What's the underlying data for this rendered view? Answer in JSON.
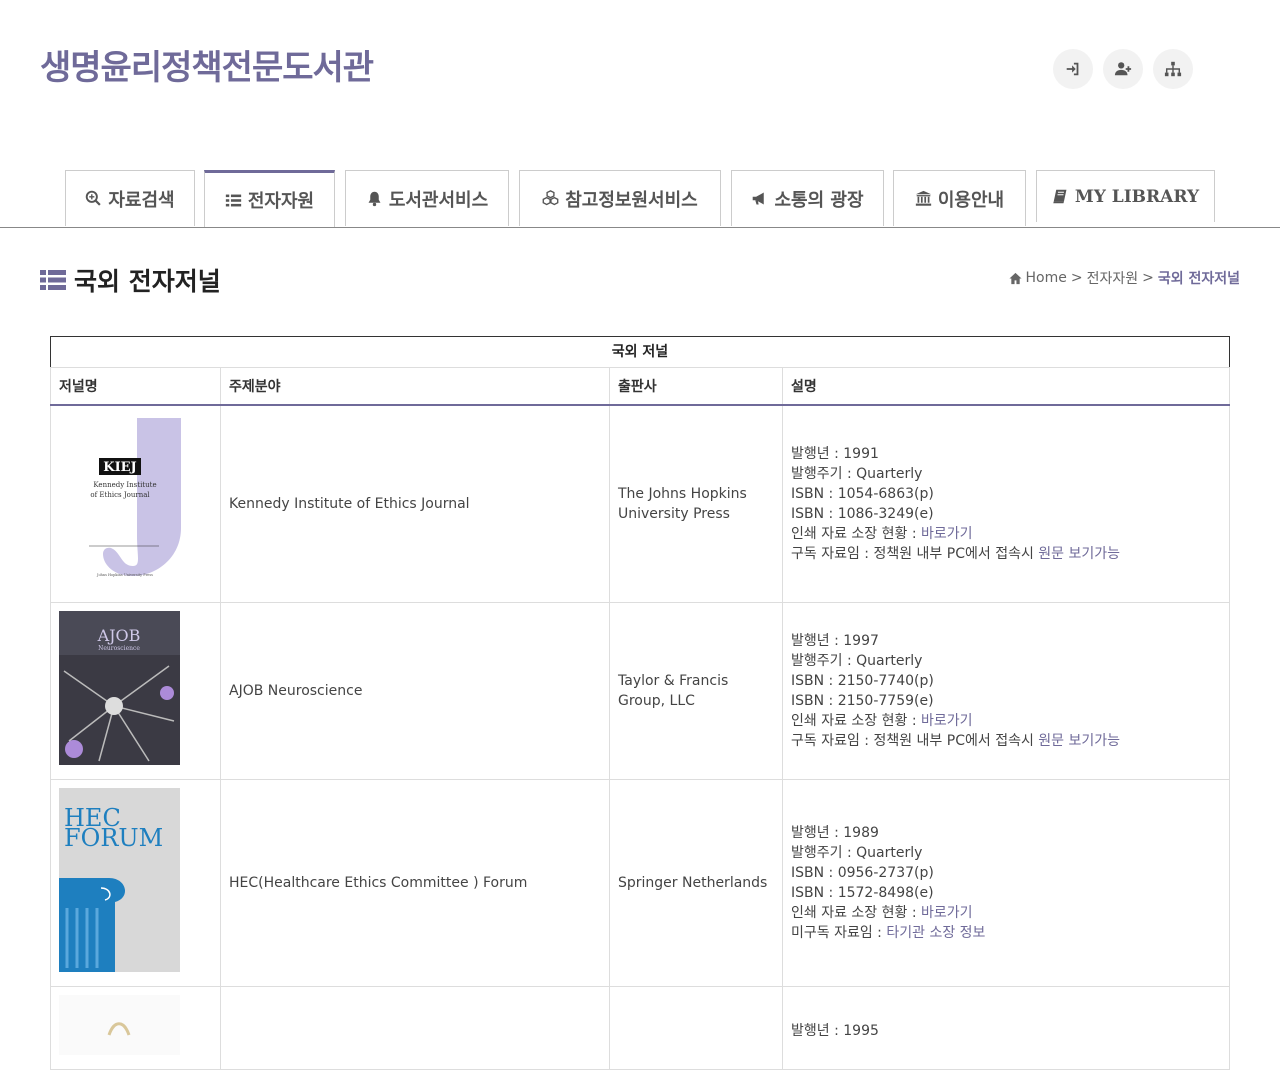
{
  "site": {
    "title": "생명윤리정책전문도서관"
  },
  "header_icons": [
    "login-icon",
    "user-plus-icon",
    "sitemap-icon"
  ],
  "nav": {
    "tabs": [
      "자료검색",
      "전자자원",
      "도서관서비스",
      "참고정보원서비스",
      "소통의 광장",
      "이용안내",
      "MY LIBRARY"
    ]
  },
  "page": {
    "title": "국외 전자저널",
    "breadcrumb": {
      "home": "Home",
      "sep": ">",
      "parent": "전자자원",
      "current": "국외 전자저널"
    }
  },
  "table": {
    "caption": "국외 저널",
    "headers": [
      "저널명",
      "주제분야",
      "출판사",
      "설명"
    ],
    "rows": [
      {
        "cover": {
          "title": "KIEJ",
          "subtitle1": "Kennedy Institute",
          "subtitle2": "of Ethics Journal",
          "footer": "Johns Hopkins University Press"
        },
        "subject": "Kennedy Institute of Ethics Journal",
        "publisher": "The Johns Hopkins University Press",
        "year": "발행년 : 1991",
        "cycle": "발행주기 : Quarterly",
        "isbn_p": "ISBN : 1054-6863(p)",
        "isbn_e": "ISBN : 1086-3249(e)",
        "print_label": "인쇄 자료 소장 현황 : ",
        "print_link": "바로가기",
        "sub_label": "구독 자료임 : 정책원 내부 PC에서 접속시 ",
        "sub_link": "원문 보기가능"
      },
      {
        "cover": {
          "title": "AJOB",
          "subtitle1": "Neuroscience"
        },
        "subject": "AJOB Neuroscience",
        "publisher": "Taylor & Francis Group, LLC",
        "year": "발행년 : 1997",
        "cycle": "발행주기 : Quarterly",
        "isbn_p": "ISBN : 2150-7740(p)",
        "isbn_e": "ISBN : 2150-7759(e)",
        "print_label": "인쇄 자료 소장 현황 : ",
        "print_link": "바로가기",
        "sub_label": "구독 자료임 : 정책원 내부 PC에서 접속시 ",
        "sub_link": "원문 보기가능"
      },
      {
        "cover": {
          "title1": "HEC",
          "title2": "FORUM"
        },
        "subject": "HEC(Healthcare Ethics Committee ) Forum",
        "publisher": "Springer Netherlands",
        "year": "발행년 : 1989",
        "cycle": "발행주기 : Quarterly",
        "isbn_p": "ISBN : 0956-2737(p)",
        "isbn_e": "ISBN : 1572-8498(e)",
        "print_label": "인쇄 자료 소장 현황 : ",
        "print_link": "바로가기",
        "sub_label": "미구독 자료임 : ",
        "sub_link": "타기관 소장 정보"
      },
      {
        "year": "발행년 : 1995"
      }
    ]
  }
}
